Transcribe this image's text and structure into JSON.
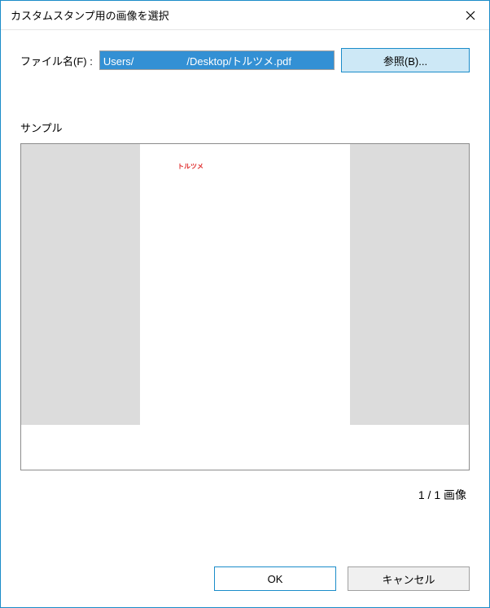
{
  "window": {
    "title": "カスタムスタンプ用の画像を選択"
  },
  "file": {
    "label": "ファイル名(F) :",
    "value": "Users/　　　　　/Desktop/トルツメ.pdf",
    "browse_label": "参照(B)..."
  },
  "sample": {
    "label": "サンプル",
    "preview_mark": "トルツメ",
    "page_count": "1 / 1 画像"
  },
  "buttons": {
    "ok": "OK",
    "cancel": "キャンセル"
  }
}
